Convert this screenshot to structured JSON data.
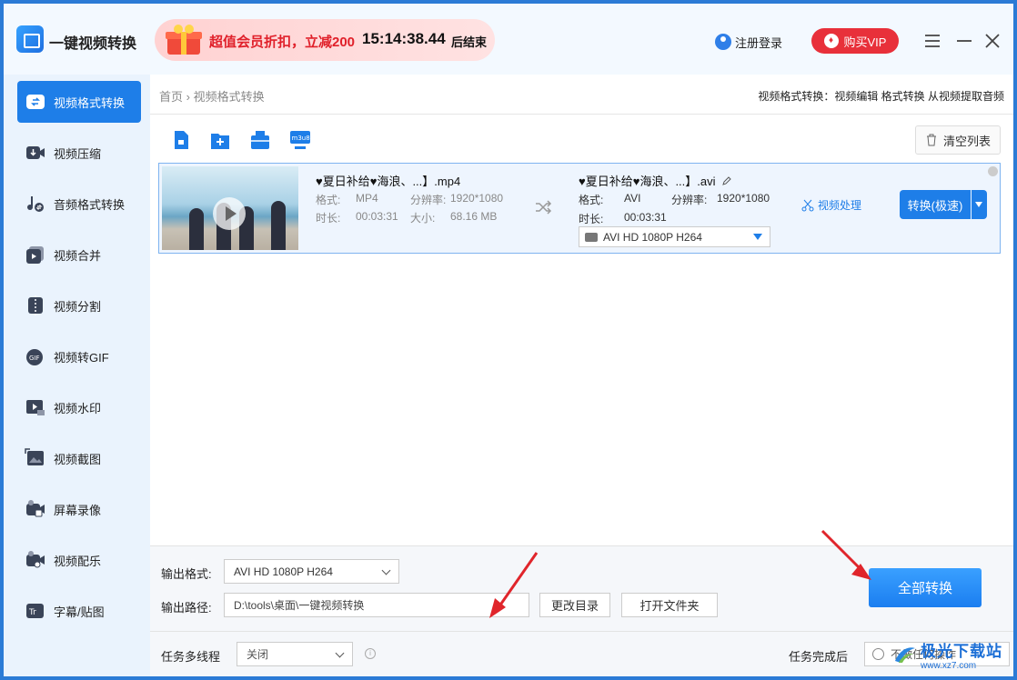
{
  "titlebar": {
    "app_title": "一键视频转换",
    "promo_text": "超值会员折扣，立减200",
    "promo_time": "15:14:38.44",
    "promo_end": "后结束",
    "login_label": "注册登录",
    "vip_label": "购买VIP"
  },
  "sidebar": {
    "items": [
      {
        "label": "视频格式转换",
        "icon": "video-convert-icon"
      },
      {
        "label": "视频压缩",
        "icon": "video-compress-icon"
      },
      {
        "label": "音频格式转换",
        "icon": "audio-convert-icon"
      },
      {
        "label": "视频合并",
        "icon": "video-merge-icon"
      },
      {
        "label": "视频分割",
        "icon": "video-split-icon"
      },
      {
        "label": "视频转GIF",
        "icon": "gif-icon"
      },
      {
        "label": "视频水印",
        "icon": "watermark-icon"
      },
      {
        "label": "视频截图",
        "icon": "screenshot-icon"
      },
      {
        "label": "屏幕录像",
        "icon": "screen-record-icon"
      },
      {
        "label": "视频配乐",
        "icon": "music-icon"
      },
      {
        "label": "字幕/贴图",
        "icon": "subtitle-icon"
      }
    ]
  },
  "breadcrumb": {
    "home": "首页",
    "sep": "›",
    "current": "视频格式转换",
    "links": "视频格式转换：视频编辑 格式转换 从视频提取音频"
  },
  "toolbar": {
    "clear_label": "清空列表",
    "m3u8_label": "m3u8"
  },
  "file_item": {
    "src_name": "♥夏日补给♥海浪、...】.mp4",
    "src_format_label": "格式:",
    "src_format": "MP4",
    "src_res_label": "分辨率:",
    "src_res": "1920*1080",
    "src_dur_label": "时长:",
    "src_dur": "00:03:31",
    "src_size_label": "大小:",
    "src_size": "68.16 MB",
    "dst_name": "♥夏日补给♥海浪、...】.avi",
    "dst_format_label": "格式:",
    "dst_format": "AVI",
    "dst_res_label": "分辨率:",
    "dst_res": "1920*1080",
    "dst_dur_label": "时长:",
    "dst_dur": "00:03:31",
    "dst_preset": "AVI  HD 1080P H264",
    "process_label": "视频处理",
    "convert_label": "转换(极速)"
  },
  "output": {
    "format_label": "输出格式:",
    "format_value": "AVI  HD 1080P H264",
    "path_label": "输出路径:",
    "path_value": "D:\\tools\\桌面\\一键视频转换",
    "change_dir": "更改目录",
    "open_folder": "打开文件夹",
    "convert_all": "全部转换"
  },
  "status": {
    "thread_label": "任务多线程",
    "thread_value": "关闭",
    "after_label": "任务完成后",
    "after_value": "不做任何操作"
  },
  "watermark": {
    "main": "极光下载站",
    "sub": "www.xz7.com"
  },
  "colors": {
    "accent": "#1e7ee8",
    "promo_red": "#e0202a",
    "annotation_arrow": "#e0252b"
  }
}
